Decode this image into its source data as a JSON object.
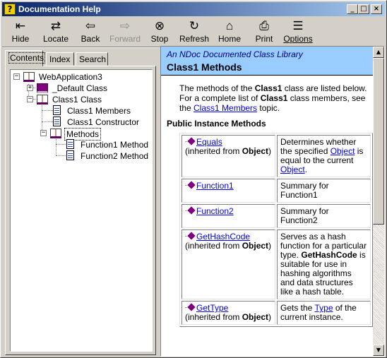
{
  "window": {
    "title": "Documentation Help"
  },
  "title_buttons": {
    "minimize": "_",
    "maximize": "□",
    "close": "×"
  },
  "toolbar": {
    "hide": "Hide",
    "locate": "Locate",
    "back": "Back",
    "forward": "Forward",
    "stop": "Stop",
    "refresh": "Refresh",
    "home": "Home",
    "print": "Print",
    "options": "Options"
  },
  "tabs": {
    "contents": "Contents",
    "index": "Index",
    "search": "Search"
  },
  "tree": {
    "root": "WebApplication3",
    "default_class": "_Default Class",
    "class1": "Class1 Class",
    "class1_members": "Class1 Members",
    "class1_constructor": "Class1 Constructor",
    "methods": "Methods",
    "function1": "Function1 Method",
    "function2": "Function2 Method"
  },
  "content": {
    "library": "An NDoc Documented Class Library",
    "title": "Class1 Methods",
    "intro_1": "The methods of the ",
    "intro_class": "Class1",
    "intro_2": " class are listed below. For a complete list of ",
    "intro_class2": "Class1",
    "intro_3": " class members, see the ",
    "intro_link": "Class1 Members",
    "intro_4": " topic.",
    "section": "Public Instance Methods",
    "methods": [
      {
        "name": "Equals",
        "inherited": "(inherited from ",
        "from": "Object",
        "close": ")",
        "d1": "Determines whether the specified ",
        "d_link": "Object",
        "d2": " is equal to the current ",
        "d_link2": "Object",
        "d3": "."
      },
      {
        "name": "Function1",
        "desc": "Summary for Function1"
      },
      {
        "name": "Function2",
        "desc": "Summary for Function2"
      },
      {
        "name": "GetHashCode",
        "inherited": "(inherited from ",
        "from": "Object",
        "close": ")",
        "d1": "Serves as a hash function for a particular type. ",
        "d_bold": "GetHashCode",
        "d2": " is suitable for use in hashing algorithms and data structures like a hash table."
      },
      {
        "name": "GetType",
        "inherited": "(inherited from ",
        "from": "Object",
        "close": ")",
        "d1": "Gets the ",
        "d_link": "Type",
        "d2": " of the current instance."
      }
    ]
  }
}
